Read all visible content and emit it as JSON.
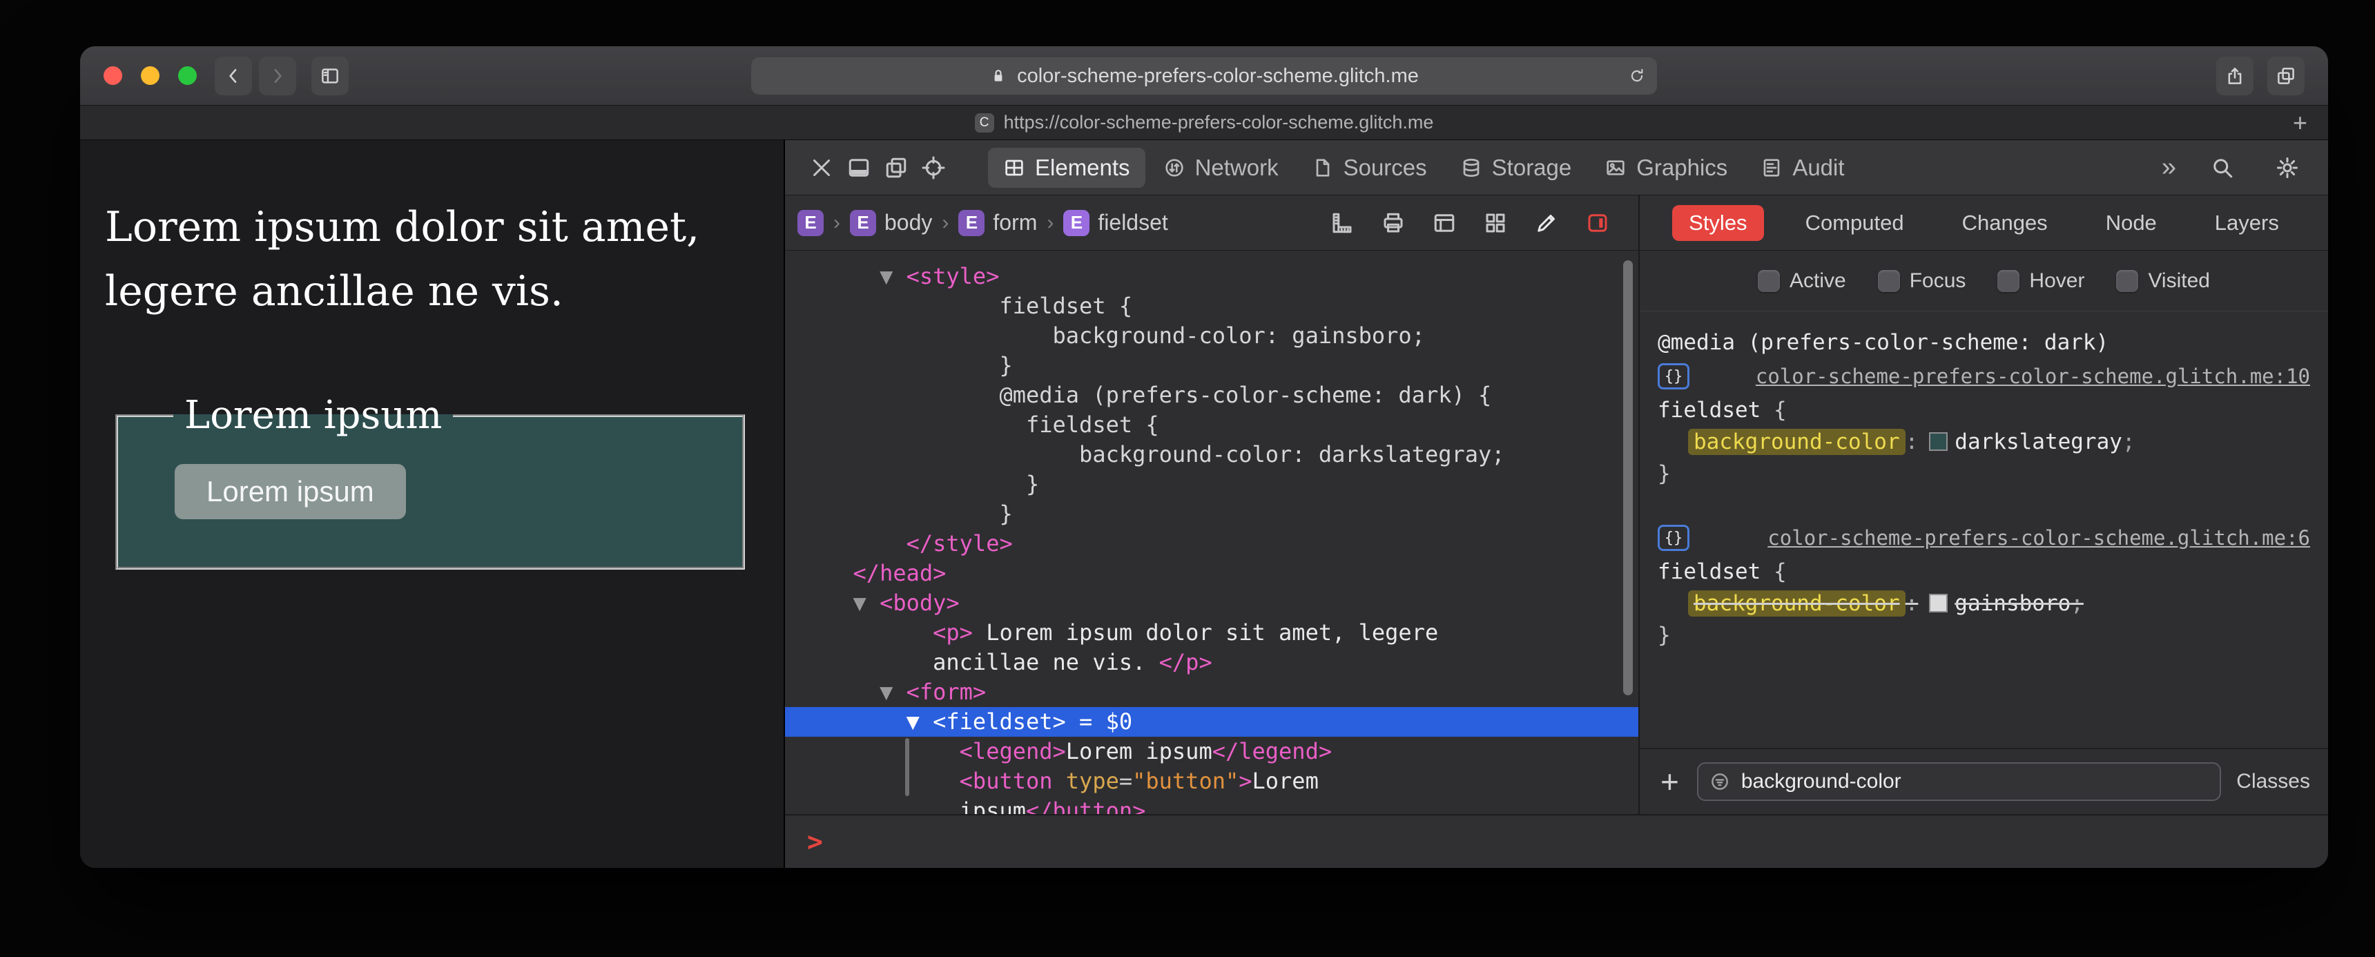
{
  "browser": {
    "url_field": {
      "text": "color-scheme-prefers-color-scheme.glitch.me"
    },
    "tab": {
      "favicon_letter": "C",
      "title": "https://color-scheme-prefers-color-scheme.glitch.me"
    },
    "new_tab_label": "+"
  },
  "page": {
    "paragraph": "Lorem ipsum dolor sit amet, legere ancillae ne vis.",
    "fieldset": {
      "legend": "Lorem ipsum",
      "button_label": "Lorem ipsum",
      "background": "#2f4f4f"
    }
  },
  "inspector": {
    "toolbar": {
      "tabs": [
        {
          "label": "Elements",
          "icon": "elements",
          "selected": true
        },
        {
          "label": "Network",
          "icon": "network",
          "selected": false
        },
        {
          "label": "Sources",
          "icon": "sources",
          "selected": false
        },
        {
          "label": "Storage",
          "icon": "storage",
          "selected": false
        },
        {
          "label": "Graphics",
          "icon": "graphics",
          "selected": false
        },
        {
          "label": "Audit",
          "icon": "audit",
          "selected": false
        }
      ],
      "more_label": "»"
    },
    "breadcrumbs": [
      {
        "badge": "E",
        "label": "",
        "selected": false
      },
      {
        "badge": "E",
        "label": "body",
        "selected": false
      },
      {
        "badge": "E",
        "label": "form",
        "selected": false
      },
      {
        "badge": "E",
        "label": "fieldset",
        "selected": true
      }
    ],
    "dom_tree": {
      "selected_index": 15,
      "lines": [
        {
          "tokens": [
            {
              "t": "tri",
              "s": "    ▼ "
            },
            {
              "t": "tag",
              "s": "<style>"
            }
          ]
        },
        {
          "tokens": [
            {
              "t": "css",
              "s": "             fieldset {"
            }
          ]
        },
        {
          "tokens": [
            {
              "t": "css",
              "s": "                 background-color: gainsboro;"
            }
          ]
        },
        {
          "tokens": [
            {
              "t": "css",
              "s": "             }"
            }
          ]
        },
        {
          "tokens": [
            {
              "t": "css",
              "s": "             @media (prefers-color-scheme: dark) {"
            }
          ]
        },
        {
          "tokens": [
            {
              "t": "css",
              "s": "               fieldset {"
            }
          ]
        },
        {
          "tokens": [
            {
              "t": "css",
              "s": "                   background-color: darkslategray;"
            }
          ]
        },
        {
          "tokens": [
            {
              "t": "css",
              "s": "               }"
            }
          ]
        },
        {
          "tokens": [
            {
              "t": "css",
              "s": "             }"
            }
          ]
        },
        {
          "tokens": [
            {
              "t": "tag",
              "s": "      </style>"
            }
          ]
        },
        {
          "tokens": [
            {
              "t": "tag",
              "s": "  </head>"
            }
          ]
        },
        {
          "tokens": [
            {
              "t": "tri",
              "s": "  ▼ "
            },
            {
              "t": "tag",
              "s": "<body>"
            }
          ]
        },
        {
          "tokens": [
            {
              "t": "tag",
              "s": "        <p>"
            },
            {
              "t": "text",
              "s": " Lorem ipsum dolor sit amet, legere"
            }
          ]
        },
        {
          "tokens": [
            {
              "t": "text",
              "s": "        ancillae ne vis. "
            },
            {
              "t": "tag",
              "s": "</p>"
            }
          ]
        },
        {
          "tokens": [
            {
              "t": "tri",
              "s": "    ▼ "
            },
            {
              "t": "tag",
              "s": "<form>"
            }
          ]
        },
        {
          "tokens": [
            {
              "t": "tri",
              "s": "      ▼ "
            },
            {
              "t": "tag",
              "s": "<fieldset>"
            },
            {
              "t": "meta",
              "s": " = $0"
            }
          ]
        },
        {
          "tokens": [
            {
              "t": "tag",
              "s": "          <legend>"
            },
            {
              "t": "text",
              "s": "Lorem ipsum"
            },
            {
              "t": "tag",
              "s": "</legend>"
            }
          ]
        },
        {
          "tokens": [
            {
              "t": "tag",
              "s": "          <button"
            },
            {
              "t": "attr",
              "s": " type"
            },
            {
              "t": "punct",
              "s": "="
            },
            {
              "t": "val",
              "s": "\"button\""
            },
            {
              "t": "tag",
              "s": ">"
            },
            {
              "t": "text",
              "s": "Lorem"
            }
          ]
        },
        {
          "tokens": [
            {
              "t": "text",
              "s": "          ipsum"
            },
            {
              "t": "tag",
              "s": "</button>"
            }
          ]
        }
      ]
    },
    "console_prompt": ">",
    "styles_sidebar": {
      "tabs": [
        {
          "label": "Styles",
          "selected": true
        },
        {
          "label": "Computed",
          "selected": false
        },
        {
          "label": "Changes",
          "selected": false
        },
        {
          "label": "Node",
          "selected": false
        },
        {
          "label": "Layers",
          "selected": false
        }
      ],
      "state_toggles": [
        {
          "label": "Active",
          "checked": false
        },
        {
          "label": "Focus",
          "checked": false
        },
        {
          "label": "Hover",
          "checked": false
        },
        {
          "label": "Visited",
          "checked": false
        }
      ],
      "rules": [
        {
          "media": "@media (prefers-color-scheme: dark)",
          "source_link": "color-scheme-prefers-color-scheme.glitch.me:10",
          "selector": "fieldset",
          "open_brace": "{",
          "close_brace": "}",
          "properties": [
            {
              "name": "background-color",
              "colon": ":",
              "value": "darkslategray",
              "semicolon": ";",
              "swatch": "#2f4f4f",
              "highlighted": true,
              "overridden": false
            }
          ]
        },
        {
          "media": "",
          "source_link": "color-scheme-prefers-color-scheme.glitch.me:6",
          "selector": "fieldset",
          "open_brace": "{",
          "close_brace": "}",
          "properties": [
            {
              "name": "background-color",
              "colon": ":",
              "value": "gainsboro",
              "semicolon": ";",
              "swatch": "#dcdcdc",
              "highlighted": true,
              "overridden": true
            }
          ]
        }
      ],
      "footer": {
        "filter_value": "background-color",
        "classes_label": "Classes"
      }
    }
  },
  "colors": {
    "selection_blue": "#2a5fdd",
    "accent_red": "#e5443f",
    "tag_pink": "#ea5fc7",
    "attr_gold": "#d9a74e",
    "value_orange": "#e2923e",
    "highlight_olive_bg": "#6b6125",
    "highlight_olive_text": "#efdb4f",
    "darkslategray_swatch": "#2f4f4f",
    "gainsboro_swatch": "#dcdcdc"
  }
}
